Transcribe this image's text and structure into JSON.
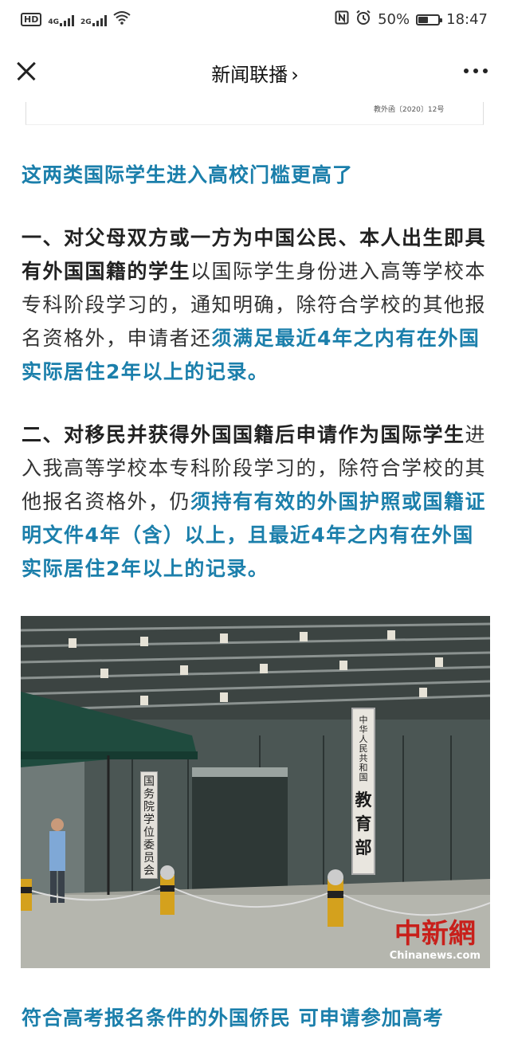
{
  "status_bar": {
    "hd": "HD",
    "net1": "4G",
    "net2": "2G",
    "battery_percent": "50%",
    "battery_level": 0.5,
    "time": "18:47",
    "icons": [
      "hd-icon",
      "signal-icon",
      "wifi-icon",
      "nfc-icon",
      "alarm-icon",
      "battery-icon"
    ]
  },
  "nav": {
    "title": "新闻联播",
    "chevron": "›",
    "close_icon": "close-icon",
    "more_icon": "more-icon"
  },
  "doc_fragment": {
    "ref": "教外函〔2020〕12号"
  },
  "article": {
    "heading1": "这两类国际学生进入高校门槛更高了",
    "p1": {
      "bold": "一、对父母双方或一方为中国公民、本人出生即具有外国国籍的学生",
      "normal": "以国际学生身份进入高等学校本专科阶段学习的，通知明确，除符合学校的其他报名资格外，申请者还",
      "blue": "须满足最近4年之内有在外国实际居住2年以上的记录。"
    },
    "p2": {
      "bold": "二、对移民并获得外国国籍后申请作为国际学生",
      "normal": "进入我高等学校本专科阶段学习的，除符合学校的其他报名资格外，仍",
      "blue": "须持有有效的外国护照或国籍证明文件4年（含）以上，且最近4年之内有在外国实际居住2年以上的记录。"
    },
    "photo": {
      "plaque_small": "中华人民共和国",
      "plaque_big": "教育部",
      "plaque2": "国务院学位委员会",
      "watermark_cn": "中新網",
      "watermark_en": "Chinanews.com"
    },
    "heading2": "符合高考报名条件的外国侨民 可申请参加高考"
  },
  "colors": {
    "accent_blue": "#1b7fab",
    "text": "#333333",
    "watermark_red": "#c8201b"
  }
}
